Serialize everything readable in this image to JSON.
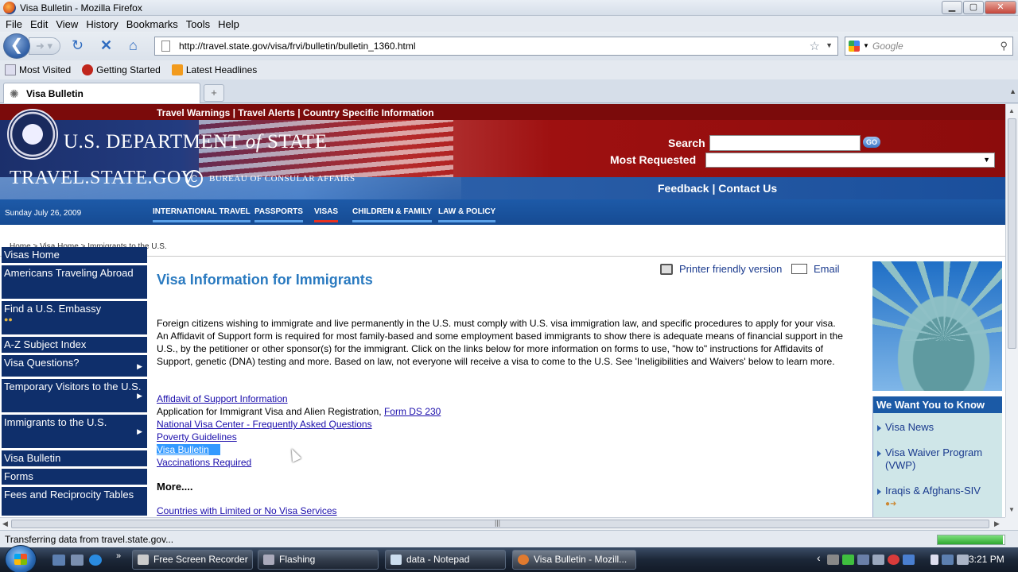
{
  "window": {
    "title": "Visa Bulletin - Mozilla Firefox"
  },
  "menu": [
    "File",
    "Edit",
    "View",
    "History",
    "Bookmarks",
    "Tools",
    "Help"
  ],
  "address": {
    "url": "http://travel.state.gov/visa/frvi/bulletin/bulletin_1360.html"
  },
  "search_engine": {
    "placeholder": "Google"
  },
  "bookmarks": [
    "Most Visited",
    "Getting Started",
    "Latest Headlines"
  ],
  "tab": {
    "title": "Visa Bulletin",
    "new_tab": "+"
  },
  "site": {
    "top_links": "Travel Warnings | Travel Alerts | Country Specific Information",
    "dept": "U.S. DEPARTMENT",
    "dept_of": "of",
    "dept_state": "STATE",
    "travel": "TRAVEL.STATE.GOV",
    "bureau": "BUREAU OF CONSULAR AFFAIRS",
    "search_label": "Search",
    "go_label": "GO",
    "most_requested_label": "Most Requested",
    "feedback": "Feedback",
    "contact": "Contact Us",
    "sep": "|",
    "date": "Sunday July 26, 2009",
    "nav": [
      "INTERNATIONAL TRAVEL",
      "PASSPORTS",
      "VISAS",
      "CHILDREN & FAMILY",
      "LAW & POLICY"
    ]
  },
  "breadcrumb": "Home > Visa Home > Immigrants to the U.S.",
  "sidebar": [
    "Visas Home",
    "Americans Traveling Abroad",
    "Find a U.S. Embassy",
    "A-Z Subject Index",
    "Visa Questions?",
    "Temporary Visitors to the U.S.",
    "Immigrants to the U.S.",
    "Visa Bulletin",
    "Forms",
    "Fees and Reciprocity Tables"
  ],
  "main": {
    "title": "Visa Information for Immigrants",
    "printer": "Printer friendly version",
    "email": "Email",
    "intro": "Foreign citizens wishing to immigrate and live permanently in the U.S. must comply with U.S. visa immigration law, and specific procedures to apply for your visa. An Affidavit of Support form is required for most family-based and some employment based immigrants to show there is adequate means of financial support in the U.S., by the petitioner or other sponsor(s) for the immigrant. Click on the links below for more information on forms to use, \"how to\" instructions for Affidavits of Support, genetic (DNA) testing and more. Based on law, not everyone will receive a visa to come to the U.S. See 'Ineligibilities and Waivers' below to learn more.",
    "link1": "Affidavit of Support Information",
    "line2_text": "Application for Immigrant Visa and Alien Registration,",
    "line2_link": "Form DS 230",
    "link3": "National Visa Center - Frequently Asked Questions",
    "link4": "Poverty Guidelines",
    "link5": "Visa Bulletin",
    "link6": "Vaccinations Required",
    "more": "More....",
    "more_link": "Countries with Limited or No Visa Services"
  },
  "right": {
    "title": "We Want You to Know",
    "items": [
      "Visa News",
      "Visa Waiver Program (VWP)",
      "Iraqis & Afghans-SIV"
    ]
  },
  "status": {
    "text": "Transferring data from travel.state.gov...",
    "progress": 0.98
  },
  "taskbar": {
    "tasks": [
      "Free Screen Recorder",
      "Flashing",
      "data - Notepad",
      "Visa Bulletin - Mozill..."
    ],
    "clock": "3:21 PM"
  }
}
